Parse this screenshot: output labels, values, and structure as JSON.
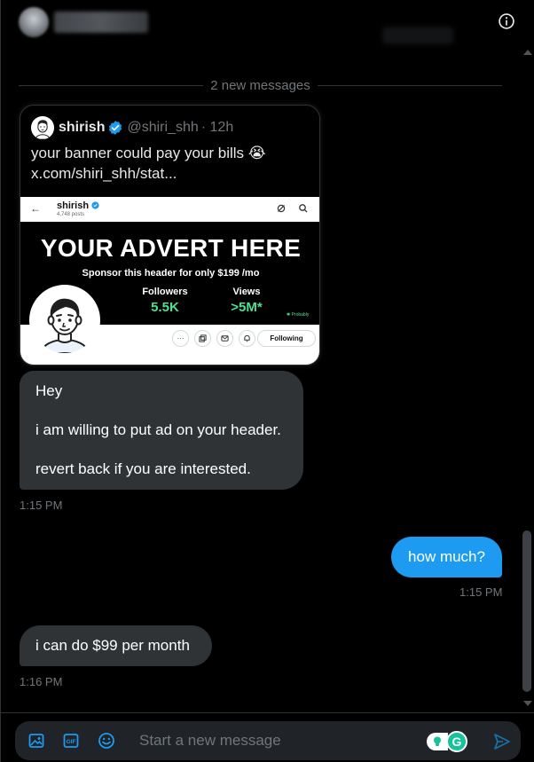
{
  "header": {
    "info_icon": "info-circle-icon"
  },
  "divider": {
    "label": "2 new messages"
  },
  "tweet": {
    "name": "shirish",
    "handle": "@shiri_shh",
    "time": "· 12h",
    "text_line1": "your banner could pay your bills 😭",
    "text_line2": "x.com/shiri_shh/stat...",
    "media": {
      "profile_name": "shirish",
      "posts": "4,748 posts",
      "advert": "YOUR ADVERT HERE",
      "sponsor": "Sponsor this header for only $199 /mo",
      "followers_label": "Followers",
      "followers_value": "5.5K",
      "views_label": "Views",
      "views_value": ">5M*",
      "footnote": "✱ Probably",
      "more": "···",
      "following_label": "Following"
    }
  },
  "messages": [
    {
      "direction": "incoming",
      "lines": [
        "Hey",
        "i am willing to put ad on your header.",
        "revert back if you are interested."
      ],
      "time": "1:15 PM"
    },
    {
      "direction": "outgoing",
      "text": "how much?",
      "time": "1:15 PM"
    },
    {
      "direction": "incoming",
      "text": "i can do $99 per month",
      "time": "1:16 PM"
    }
  ],
  "composer": {
    "placeholder": "Start a new message",
    "grammarly_letter": "G"
  },
  "colors": {
    "accent": "#1d9bf0",
    "bubble_incoming": "#2f3336",
    "green_stat": "#4fe08f"
  }
}
